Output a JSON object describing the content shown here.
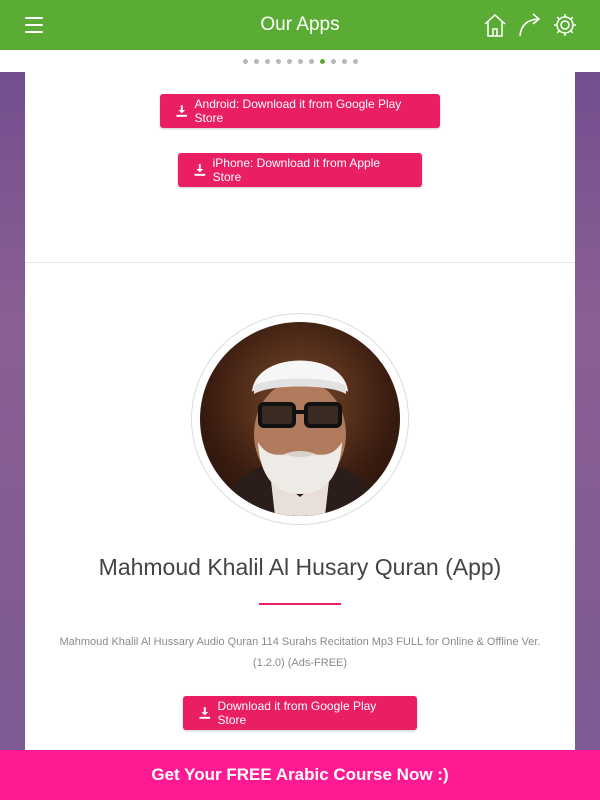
{
  "header": {
    "title": "Our Apps",
    "menu_icon": "hamburger-menu-icon",
    "icons": [
      "home-icon",
      "share-icon",
      "settings-icon"
    ],
    "background": "#5aac35"
  },
  "pager": {
    "count": 11,
    "active_index": 7,
    "active_color": "#5aac35"
  },
  "previous_app": {
    "android_button": "Android: Download it from Google Play Store",
    "iphone_button": "iPhone: Download it from Apple Store"
  },
  "app": {
    "title": "Mahmoud Khalil Al Husary Quran (App)",
    "description": "Mahmoud Khalil Al Hussary Audio Quran 114 Surahs Recitation Mp3 FULL for Online & Offline Ver. (1.2.0) (Ads-FREE)",
    "download_button": "Download it from Google Play Store"
  },
  "banner": {
    "text": "Get Your FREE Arabic Course Now :)",
    "color": "#ff1a93"
  },
  "accent_color": "#e91e63"
}
